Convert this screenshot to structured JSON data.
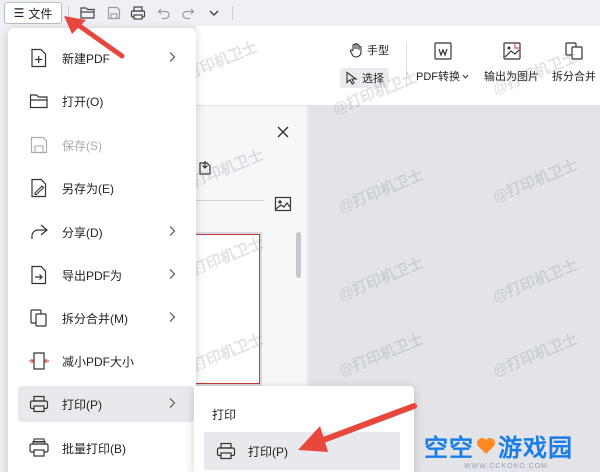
{
  "topbar": {
    "file_label": "文件",
    "menu_glyph": "☰",
    "quick_icons": [
      "folder-open-icon",
      "save-icon",
      "print-icon",
      "undo-icon",
      "redo-icon",
      "chevron-down-icon"
    ]
  },
  "ribbon": {
    "hand_label": "手型",
    "select_label": "选择",
    "pdf_convert_label": "PDF转换",
    "export_image_label": "输出为图片",
    "split_merge_label": "拆分合并"
  },
  "menu": {
    "items": [
      {
        "label": "新建PDF",
        "icon": "new-pdf-icon",
        "submenu": true,
        "disabled": false
      },
      {
        "label": "打开(O)",
        "icon": "folder-icon",
        "submenu": false,
        "disabled": false
      },
      {
        "label": "保存(S)",
        "icon": "save-icon",
        "submenu": false,
        "disabled": true
      },
      {
        "label": "另存为(E)",
        "icon": "save-as-icon",
        "submenu": false,
        "disabled": false
      },
      {
        "label": "分享(D)",
        "icon": "share-icon",
        "submenu": true,
        "disabled": false
      },
      {
        "label": "导出PDF为",
        "icon": "export-pdf-icon",
        "submenu": true,
        "disabled": false
      },
      {
        "label": "拆分合并(M)",
        "icon": "split-merge-icon",
        "submenu": true,
        "disabled": false
      },
      {
        "label": "减小PDF大小",
        "icon": "compress-icon",
        "submenu": false,
        "disabled": false
      },
      {
        "label": "打印(P)",
        "icon": "printer-icon",
        "submenu": true,
        "disabled": false
      },
      {
        "label": "批量打印(B)",
        "icon": "batch-print-icon",
        "submenu": false,
        "disabled": false
      }
    ]
  },
  "submenu": {
    "title": "打印",
    "item_label": "打印(P)"
  },
  "watermark": "@打印机卫士",
  "brand": {
    "name_part1": "空空",
    "name_part2": "游戏园",
    "url": "WWW.CCKOKO.COM"
  },
  "colors": {
    "accent_red": "#e8473c",
    "brand_blue": "#1b7ee8",
    "brand_orange": "#ff8a1f"
  }
}
